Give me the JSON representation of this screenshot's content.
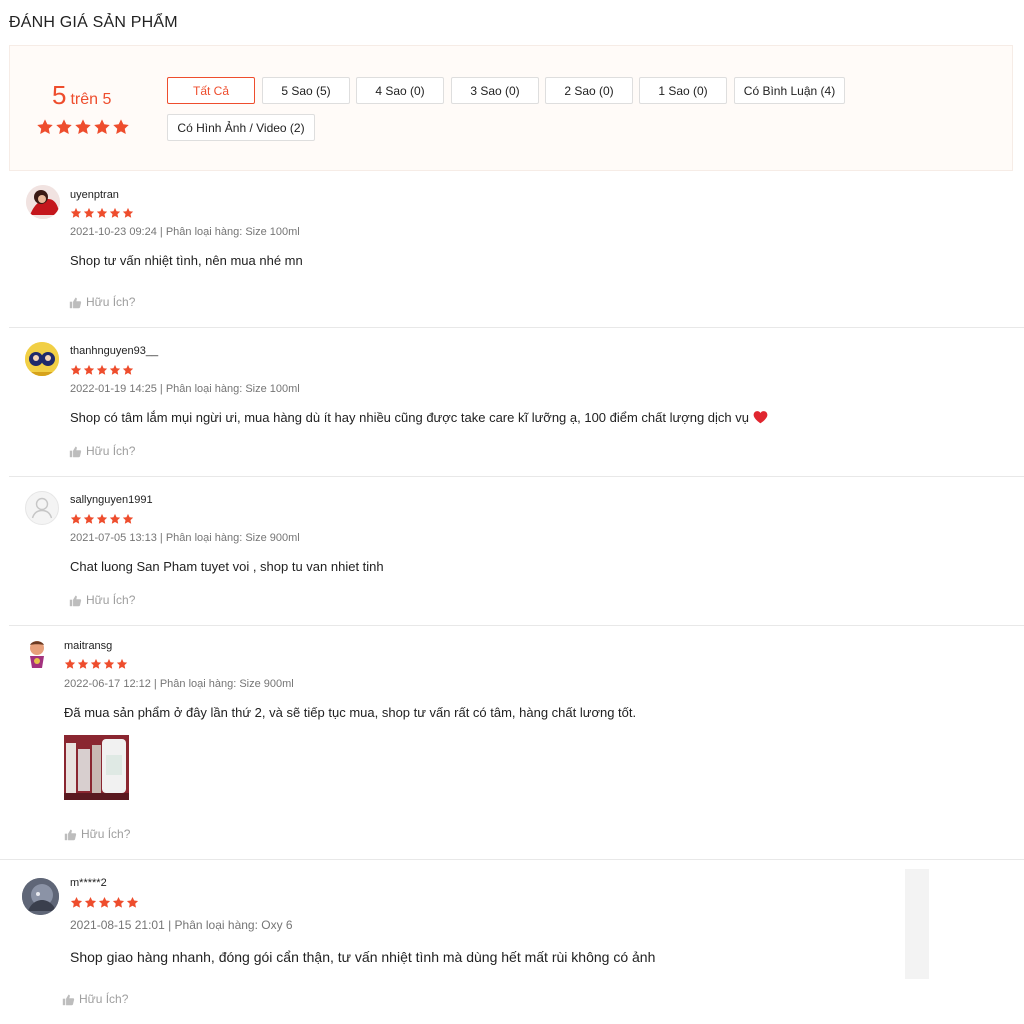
{
  "page_title": "ĐÁNH GIÁ SẢN PHẨM",
  "rating": {
    "score": "5",
    "of_label": "trên 5",
    "stars": 5
  },
  "filters": [
    {
      "label": "Tất Cả",
      "active": true
    },
    {
      "label": "5 Sao (5)"
    },
    {
      "label": "4 Sao (0)"
    },
    {
      "label": "3 Sao (0)"
    },
    {
      "label": "2 Sao (0)"
    },
    {
      "label": "1 Sao (0)"
    },
    {
      "label": "Có Bình Luận (4)"
    },
    {
      "label": "Có Hình Ảnh / Video (2)"
    }
  ],
  "reviews": [
    {
      "username": "uyenptran",
      "stars": 5,
      "meta": "2021-10-23 09:24 | Phân loại hàng: Size 100ml",
      "content": "Shop tư vấn nhiệt tình, nên mua nhé mn",
      "helpful": "Hữu Ích?"
    },
    {
      "username": "thanhnguyen93__",
      "stars": 5,
      "meta": "2022-01-19 14:25 | Phân loại hàng: Size 100ml",
      "content": "Shop có tâm lắm mụi ngừi ưi, mua hàng dù ít hay nhiều cũng được take care kĩ lưỡng ạ, 100 điểm chất lượng dịch vụ",
      "helpful": "Hữu Ích?"
    },
    {
      "username": "sallynguyen1991",
      "stars": 5,
      "meta": "2021-07-05 13:13 | Phân loại hàng: Size 900ml",
      "content": "Chat luong San Pham tuyet voi , shop tu van nhiet tinh",
      "helpful": "Hữu Ích?"
    },
    {
      "username": "maitransg",
      "stars": 5,
      "meta": "2022-06-17 12:12 | Phân loại hàng: Size 900ml",
      "content": "Đã mua sản phẩm ở đây lần thứ 2, và sẽ tiếp tục mua, shop tư vấn rất có tâm, hàng chất lương tốt.",
      "helpful": "Hữu Ích?"
    },
    {
      "username": "m*****2",
      "stars": 5,
      "meta": "2021-08-15 21:01 | Phân loại hàng: Oxy 6",
      "content": "Shop giao hàng nhanh, đóng gói cẩn thận, tư vấn nhiệt tình mà dùng hết mất rùi không có ảnh",
      "helpful": "Hữu Ích?"
    }
  ],
  "colors": {
    "accent": "#ee4d2d",
    "overview_bg": "#fffbf8",
    "muted": "#757575"
  },
  "icons": {
    "star": "star-icon",
    "thumb": "thumbs-up-icon",
    "heart": "heart-icon",
    "default_avatar": "user-icon"
  }
}
